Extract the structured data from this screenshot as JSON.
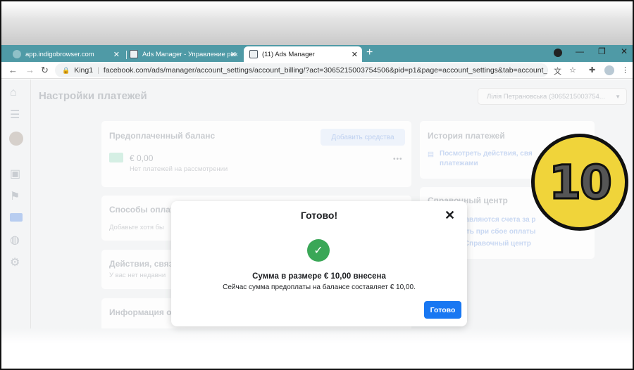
{
  "browser": {
    "tabs": [
      {
        "label": "app.indigobrowser.com"
      },
      {
        "label": "Ads Manager - Управление рек"
      },
      {
        "label": "(11) Ads Manager"
      }
    ],
    "profile": "King1",
    "url": "facebook.com/ads/manager/account_settings/account_billing/?act=3065215003754506&pid=p1&page=account_settings&tab=account_billing_s..."
  },
  "page": {
    "title": "Настройки платежей",
    "account_selector": "Лілія Петрановська (3065215003754..."
  },
  "prepaid": {
    "title": "Предоплаченный баланс",
    "add_funds": "Добавить средства",
    "balance": "€ 0,00",
    "pending": "Нет платежей на рассмотрении"
  },
  "methods": {
    "title": "Способы оплат",
    "subtitle": "Добавьте хотя бы"
  },
  "actions": {
    "title": "Действия, связ",
    "subtitle": "У вас нет недавни"
  },
  "info": {
    "title": "Информация о"
  },
  "history": {
    "title": "История платежей",
    "link_line1": "Посмотреть действия, свя",
    "link_line2": "платежами"
  },
  "help": {
    "title": "Справочный центр",
    "link1": "ставляются счета за р",
    "link2": "лать при сбое оплаты",
    "link3": "ь Справочный центр"
  },
  "modal": {
    "title": "Готово!",
    "headline": "Сумма в размере € 10,00 внесена",
    "text": "Сейчас сумма предоплаты на балансе составляет € 10,00.",
    "button": "Готово"
  },
  "badge": {
    "number": "10"
  }
}
